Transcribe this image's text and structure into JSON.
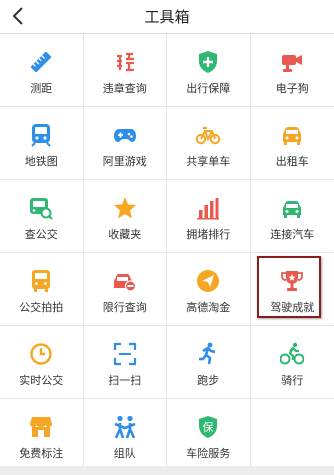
{
  "header": {
    "title": "工具箱",
    "back_icon": "chevron-left-icon"
  },
  "tools": [
    {
      "key": "ruler",
      "label": "测距",
      "icon": "ruler-icon",
      "color": "#2f8ee5"
    },
    {
      "key": "violation",
      "label": "违章查询",
      "icon": "violation-icon",
      "color": "#e85a4f"
    },
    {
      "key": "insurance",
      "label": "出行保障",
      "icon": "shield-plus-icon",
      "color": "#2eb872"
    },
    {
      "key": "camera",
      "label": "电子狗",
      "icon": "camera-icon",
      "color": "#e85a4f"
    },
    {
      "key": "subway",
      "label": "地铁图",
      "icon": "subway-icon",
      "color": "#2f8ee5"
    },
    {
      "key": "games",
      "label": "阿里游戏",
      "icon": "gamepad-icon",
      "color": "#2f8ee5"
    },
    {
      "key": "bike",
      "label": "共享单车",
      "icon": "bicycle-icon",
      "color": "#f5a623"
    },
    {
      "key": "taxi",
      "label": "出租车",
      "icon": "taxi-icon",
      "color": "#f5a623"
    },
    {
      "key": "bus",
      "label": "查公交",
      "icon": "bus-search-icon",
      "color": "#2eb872"
    },
    {
      "key": "favorites",
      "label": "收藏夹",
      "icon": "star-icon",
      "color": "#f5a623"
    },
    {
      "key": "ranking",
      "label": "拥堵排行",
      "icon": "bar-chart-icon",
      "color": "#e85a4f"
    },
    {
      "key": "connect",
      "label": "连接汽车",
      "icon": "car-icon",
      "color": "#2eb872"
    },
    {
      "key": "busphoto",
      "label": "公交拍拍",
      "icon": "bus-photo-icon",
      "color": "#f5a623"
    },
    {
      "key": "restrict",
      "label": "限行查询",
      "icon": "restrict-car-icon",
      "color": "#e85a4f"
    },
    {
      "key": "gold",
      "label": "高德淘金",
      "icon": "send-icon",
      "color": "#f5a623"
    },
    {
      "key": "achieve",
      "label": "驾驶成就",
      "icon": "trophy-icon",
      "color": "#e85a4f"
    },
    {
      "key": "realtime",
      "label": "实时公交",
      "icon": "clock-icon",
      "color": "#f5a623"
    },
    {
      "key": "scan",
      "label": "扫一扫",
      "icon": "scan-icon",
      "color": "#2f8ee5"
    },
    {
      "key": "run",
      "label": "跑步",
      "icon": "runner-icon",
      "color": "#2f8ee5"
    },
    {
      "key": "ride",
      "label": "骑行",
      "icon": "cyclist-icon",
      "color": "#2eb872"
    },
    {
      "key": "mark",
      "label": "免费标注",
      "icon": "store-icon",
      "color": "#f5a623"
    },
    {
      "key": "team",
      "label": "组队",
      "icon": "team-icon",
      "color": "#2f8ee5"
    },
    {
      "key": "carins",
      "label": "车险服务",
      "icon": "insurance-badge-icon",
      "color": "#2eb872",
      "badge_text": "保"
    }
  ]
}
